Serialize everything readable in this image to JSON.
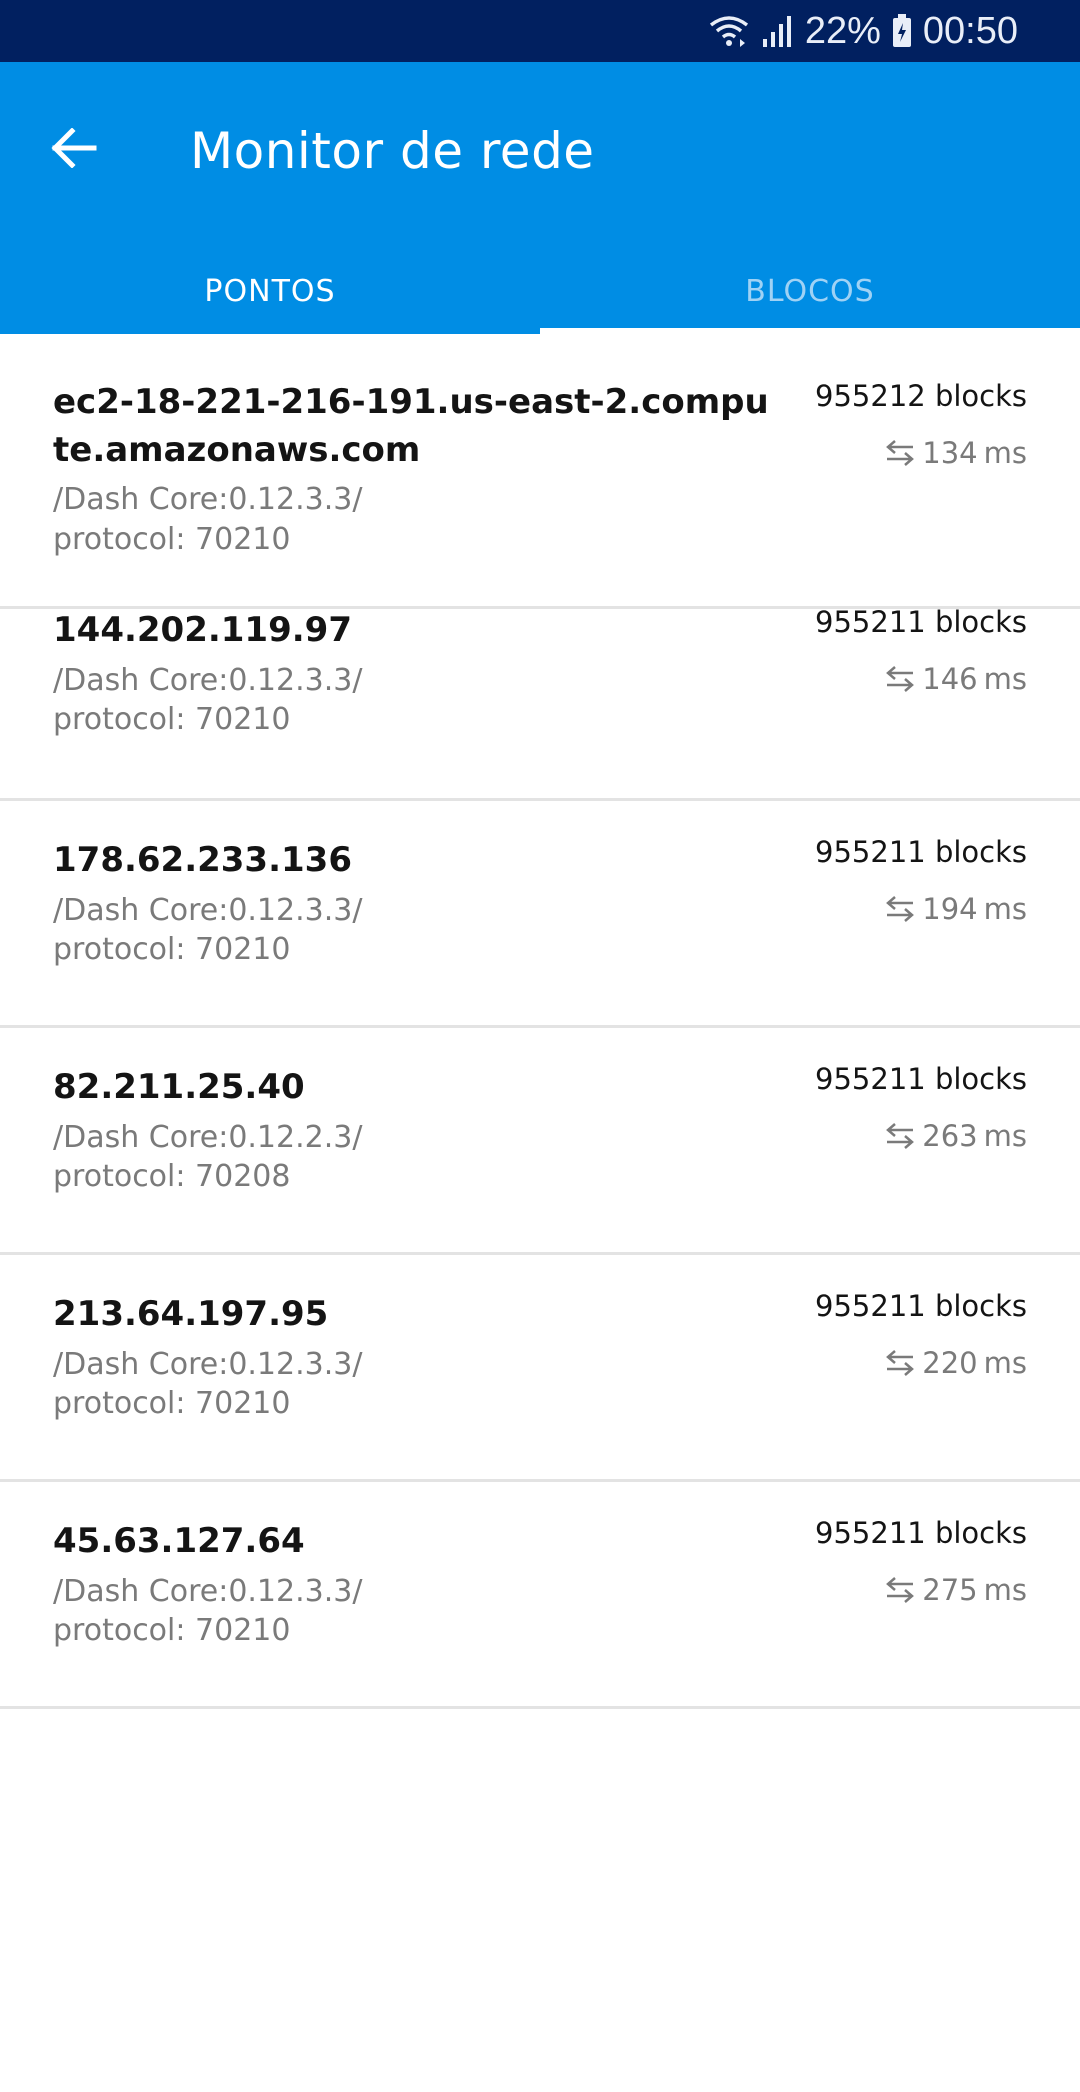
{
  "status_bar": {
    "battery": "22%",
    "time": "00:50",
    "icons": [
      "wifi-icon",
      "signal-icon",
      "battery-icon"
    ]
  },
  "app_bar": {
    "title": "Monitor de rede",
    "back_icon": "arrow-left-icon"
  },
  "tabs": [
    {
      "label": "PONTOS",
      "active": true
    },
    {
      "label": "BLOCOS",
      "active": false
    }
  ],
  "peers": [
    {
      "host": "ec2-18-221-216-191.us-east-2.compute.amazonaws.com",
      "version": "/Dash Core:0.12.3.3/",
      "protocol": "protocol: 70210",
      "blocks": "955212 blocks",
      "ping": "134",
      "ping_unit": "ms"
    },
    {
      "host": "144.202.119.97",
      "version": "/Dash Core:0.12.3.3/",
      "protocol": "protocol: 70210",
      "blocks": "955211 blocks",
      "ping": "146",
      "ping_unit": "ms"
    },
    {
      "host": "178.62.233.136",
      "version": "/Dash Core:0.12.3.3/",
      "protocol": "protocol: 70210",
      "blocks": "955211 blocks",
      "ping": "194",
      "ping_unit": "ms"
    },
    {
      "host": "82.211.25.40",
      "version": "/Dash Core:0.12.2.3/",
      "protocol": "protocol: 70208",
      "blocks": "955211 blocks",
      "ping": "263",
      "ping_unit": "ms"
    },
    {
      "host": "213.64.197.95",
      "version": "/Dash Core:0.12.3.3/",
      "protocol": "protocol: 70210",
      "blocks": "955211 blocks",
      "ping": "220",
      "ping_unit": "ms"
    },
    {
      "host": "45.63.127.64",
      "version": "/Dash Core:0.12.3.3/",
      "protocol": "protocol: 70210",
      "blocks": "955211 blocks",
      "ping": "275",
      "ping_unit": "ms"
    }
  ],
  "colors": {
    "status_bar": "#012060",
    "app_bar": "#008de4",
    "tab_active": "#ffffff",
    "tab_inactive": "#9fd2f5"
  }
}
